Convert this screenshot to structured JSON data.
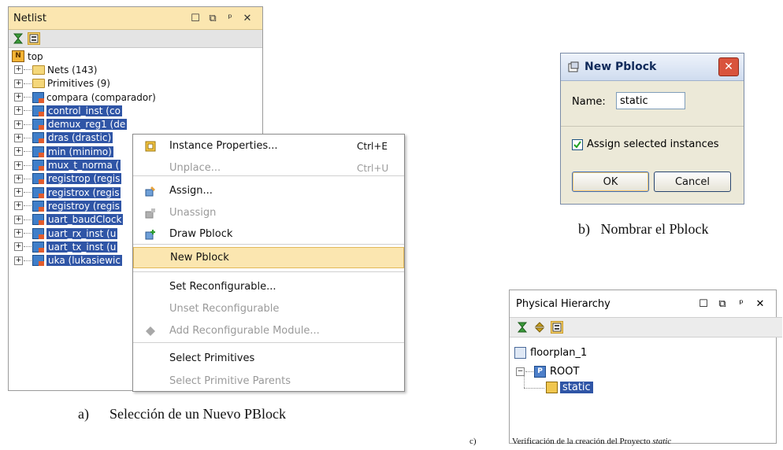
{
  "netlist": {
    "title": "Netlist",
    "root": "top",
    "rows": [
      {
        "label": "Nets (143)",
        "kind": "folder",
        "sel": false
      },
      {
        "label": "Primitives (9)",
        "kind": "folder",
        "sel": false
      },
      {
        "label": "compara (comparador)",
        "kind": "cell",
        "sel": false
      },
      {
        "label": "control_inst (co",
        "kind": "cell",
        "sel": true
      },
      {
        "label": "demux_reg1 (de",
        "kind": "cell",
        "sel": true
      },
      {
        "label": "dras (drastic)",
        "kind": "cell",
        "sel": true
      },
      {
        "label": "min (minimo)",
        "kind": "cell",
        "sel": true
      },
      {
        "label": "mux_t_norma (",
        "kind": "cell",
        "sel": true
      },
      {
        "label": "registrop (regis",
        "kind": "cell",
        "sel": true
      },
      {
        "label": "registrox (regis",
        "kind": "cell",
        "sel": true
      },
      {
        "label": "registroy (regis",
        "kind": "cell",
        "sel": true
      },
      {
        "label": "uart_baudClock",
        "kind": "cell",
        "sel": true
      },
      {
        "label": "uart_rx_inst (u",
        "kind": "cell",
        "sel": true
      },
      {
        "label": "uart_tx_inst (u",
        "kind": "cell",
        "sel": true
      },
      {
        "label": "uka (lukasiewic",
        "kind": "cell",
        "sel": true
      }
    ]
  },
  "menu": {
    "items": [
      {
        "label": "Instance Properties...",
        "shortcut": "Ctrl+E",
        "disabled": false
      },
      {
        "label": "Unplace...",
        "shortcut": "Ctrl+U",
        "disabled": true
      },
      {
        "label": "Assign...",
        "shortcut": "",
        "disabled": false
      },
      {
        "label": "Unassign",
        "shortcut": "",
        "disabled": true
      },
      {
        "label": "Draw Pblock",
        "shortcut": "",
        "disabled": false
      },
      {
        "label": "New Pblock",
        "shortcut": "",
        "disabled": false
      },
      {
        "label": "Set Reconfigurable...",
        "shortcut": "",
        "disabled": false
      },
      {
        "label": "Unset Reconfigurable",
        "shortcut": "",
        "disabled": true
      },
      {
        "label": "Add Reconfigurable Module...",
        "shortcut": "",
        "disabled": true
      },
      {
        "label": "Select Primitives",
        "shortcut": "",
        "disabled": false
      },
      {
        "label": "Select Primitive Parents",
        "shortcut": "",
        "disabled": true
      }
    ]
  },
  "dialog": {
    "title": "New Pblock",
    "name_label": "Name:",
    "name_value": "static",
    "checkbox_label": "Assign selected instances",
    "ok": "OK",
    "cancel": "Cancel"
  },
  "physical": {
    "title": "Physical Hierarchy",
    "floorplan": "floorplan_1",
    "root": "ROOT",
    "static": "static"
  },
  "captions": {
    "a_letter": "a)",
    "a_text": "Selección de un Nuevo PBlock",
    "b": "b)   Nombrar el Pblock",
    "c_letter": "c)",
    "c_text": "Verificación de la creación del Proyecto",
    "c_italic": "static"
  }
}
